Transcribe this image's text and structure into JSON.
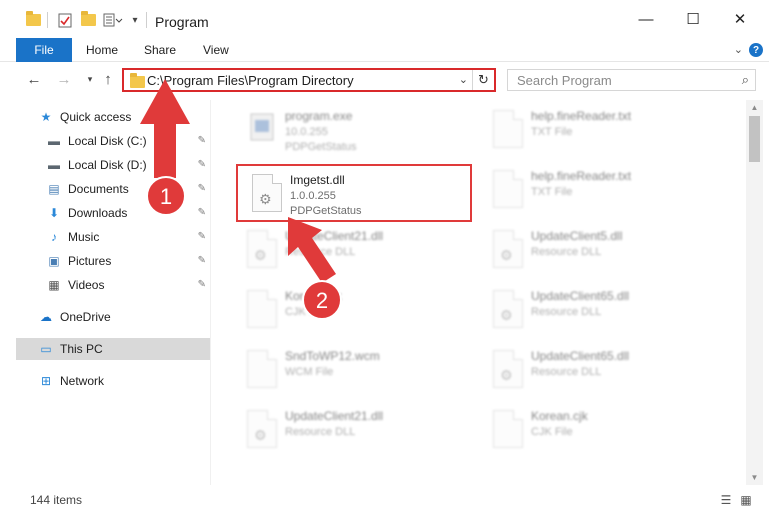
{
  "window": {
    "title": "Program",
    "minimize_glyph": "—",
    "maximize_glyph": "☐",
    "close_glyph": "✕"
  },
  "ribbon": {
    "tabs": [
      "File",
      "Home",
      "Share",
      "View"
    ],
    "expand_glyph": "⌄",
    "help_glyph": "?"
  },
  "address": {
    "path": "C:\\Program Files\\Program Directory",
    "dropdown_glyph": "⌄",
    "refresh_glyph": "↻"
  },
  "search": {
    "placeholder": "Search Program",
    "icon": "search-icon"
  },
  "sidebar": {
    "items": [
      {
        "label": "Quick access",
        "icon": "star-icon",
        "glyph": "★",
        "color": "#2b88d8",
        "pinned": false
      },
      {
        "label": "Local Disk (C:)",
        "icon": "drive-icon",
        "glyph": "▬",
        "color": "#5c6770",
        "pinned": true
      },
      {
        "label": "Local Disk (D:)",
        "icon": "drive-icon",
        "glyph": "▬",
        "color": "#5c6770",
        "pinned": true
      },
      {
        "label": "Documents",
        "icon": "document-icon",
        "glyph": "▤",
        "color": "#4a7fb5",
        "pinned": true
      },
      {
        "label": "Downloads",
        "icon": "download-icon",
        "glyph": "⬇",
        "color": "#2b88d8",
        "pinned": true
      },
      {
        "label": "Music",
        "icon": "music-icon",
        "glyph": "♪",
        "color": "#2b88d8",
        "pinned": true
      },
      {
        "label": "Pictures",
        "icon": "picture-icon",
        "glyph": "▣",
        "color": "#4a7fb5",
        "pinned": true
      },
      {
        "label": "Videos",
        "icon": "video-icon",
        "glyph": "▦",
        "color": "#555555",
        "pinned": true
      },
      {
        "label": "OneDrive",
        "icon": "cloud-icon",
        "glyph": "☁",
        "color": "#1a73c8",
        "pinned": false
      },
      {
        "label": "This PC",
        "icon": "computer-icon",
        "glyph": "▭",
        "color": "#2b88d8",
        "pinned": false
      },
      {
        "label": "Network",
        "icon": "network-icon",
        "glyph": "⊞",
        "color": "#2b88d8",
        "pinned": false
      }
    ],
    "pin_glyph": "📌"
  },
  "files": [
    {
      "name": "program.exe",
      "line2": "10.0.255",
      "line3": "PDPGetStatus",
      "icon": "exe-icon",
      "blurred": true
    },
    {
      "name": "help.fineReader.txt",
      "line2": "TXT File",
      "line3": "",
      "icon": "file-icon",
      "blurred": true
    },
    {
      "name": "Imgetst.dll",
      "line2": "1.0.0.255",
      "line3": "PDPGetStatus",
      "icon": "dll-icon",
      "blurred": false
    },
    {
      "name": "help.fineReader.txt",
      "line2": "TXT File",
      "line3": "",
      "icon": "file-icon",
      "blurred": true
    },
    {
      "name": "UpdateClient21.dll",
      "line2": "Resource DLL",
      "line3": "",
      "icon": "dll-icon",
      "blurred": true
    },
    {
      "name": "UpdateClient5.dll",
      "line2": "Resource DLL",
      "line3": "",
      "icon": "dll-icon",
      "blurred": true
    },
    {
      "name": "Korean.cjk",
      "line2": "CJK File",
      "line3": "",
      "icon": "file-icon",
      "blurred": true
    },
    {
      "name": "UpdateClient65.dll",
      "line2": "Resource DLL",
      "line3": "",
      "icon": "dll-icon",
      "blurred": true
    },
    {
      "name": "SndToWP12.wcm",
      "line2": "WCM File",
      "line3": "",
      "icon": "file-icon",
      "blurred": true
    },
    {
      "name": "UpdateClient65.dll",
      "line2": "Resource DLL",
      "line3": "",
      "icon": "dll-icon",
      "blurred": true
    },
    {
      "name": "UpdateClient21.dll",
      "line2": "Resource DLL",
      "line3": "",
      "icon": "dll-icon",
      "blurred": true
    },
    {
      "name": "Korean.cjk",
      "line2": "CJK File",
      "line3": "",
      "icon": "file-icon",
      "blurred": true
    }
  ],
  "annotations": {
    "step1": "1",
    "step2": "2",
    "color": "#e03a3a"
  },
  "status": {
    "item_count": "144 items"
  }
}
